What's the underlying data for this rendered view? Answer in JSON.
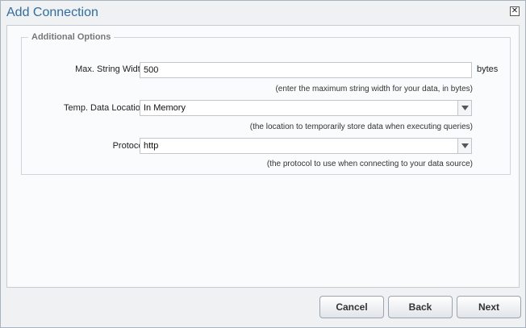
{
  "dialog": {
    "title": "Add Connection",
    "close_icon": "close-icon"
  },
  "section": {
    "legend": "Additional Options"
  },
  "fields": {
    "max_string_width": {
      "label": "Max. String Width:",
      "value": "500",
      "unit": "bytes",
      "hint": "(enter the maximum string width for your data, in bytes)"
    },
    "temp_data_location": {
      "label": "Temp. Data Location:",
      "value": "In Memory",
      "hint": "(the location to temporarily store data when executing queries)"
    },
    "protocol": {
      "label": "Protocol:",
      "value": "http",
      "hint": "(the protocol to use when connecting to your data source)"
    }
  },
  "buttons": {
    "cancel": "Cancel",
    "back": "Back",
    "next": "Next"
  },
  "colors": {
    "title": "#2f6ea3",
    "background": "#eff1f3"
  }
}
